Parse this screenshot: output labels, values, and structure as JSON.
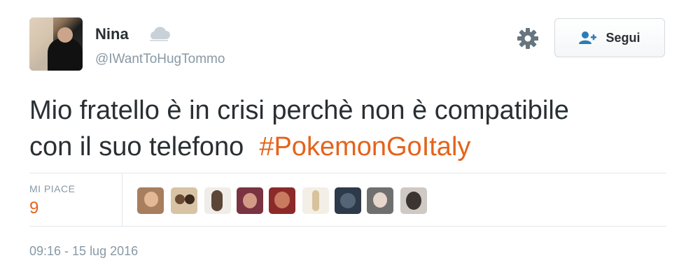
{
  "user": {
    "name": "Nina",
    "handle": "@IWantToHugTommo"
  },
  "actions": {
    "follow_label": "Segui"
  },
  "tweet": {
    "text_line1": "Mio fratello è in crisi perchè non è compatibile",
    "text_line2": "con il suo telefono",
    "hashtag": "#PokemonGoItaly"
  },
  "stats": {
    "likes_label": "MI PIACE",
    "likes_count": "9"
  },
  "likers": [
    {
      "name": "liker-1"
    },
    {
      "name": "liker-2"
    },
    {
      "name": "liker-3"
    },
    {
      "name": "liker-4"
    },
    {
      "name": "liker-5"
    },
    {
      "name": "liker-6"
    },
    {
      "name": "liker-7"
    },
    {
      "name": "liker-8"
    },
    {
      "name": "liker-9"
    }
  ],
  "timestamp": "09:16 - 15 lug 2016",
  "colors": {
    "hashtag": "#e4631b",
    "likes_count": "#e4631b",
    "follow_icon": "#2b7bb9",
    "secondary_text": "#8899a6"
  },
  "icons": {
    "weather": "cloud-icon",
    "settings": "gear-icon",
    "follow": "add-user-icon"
  }
}
